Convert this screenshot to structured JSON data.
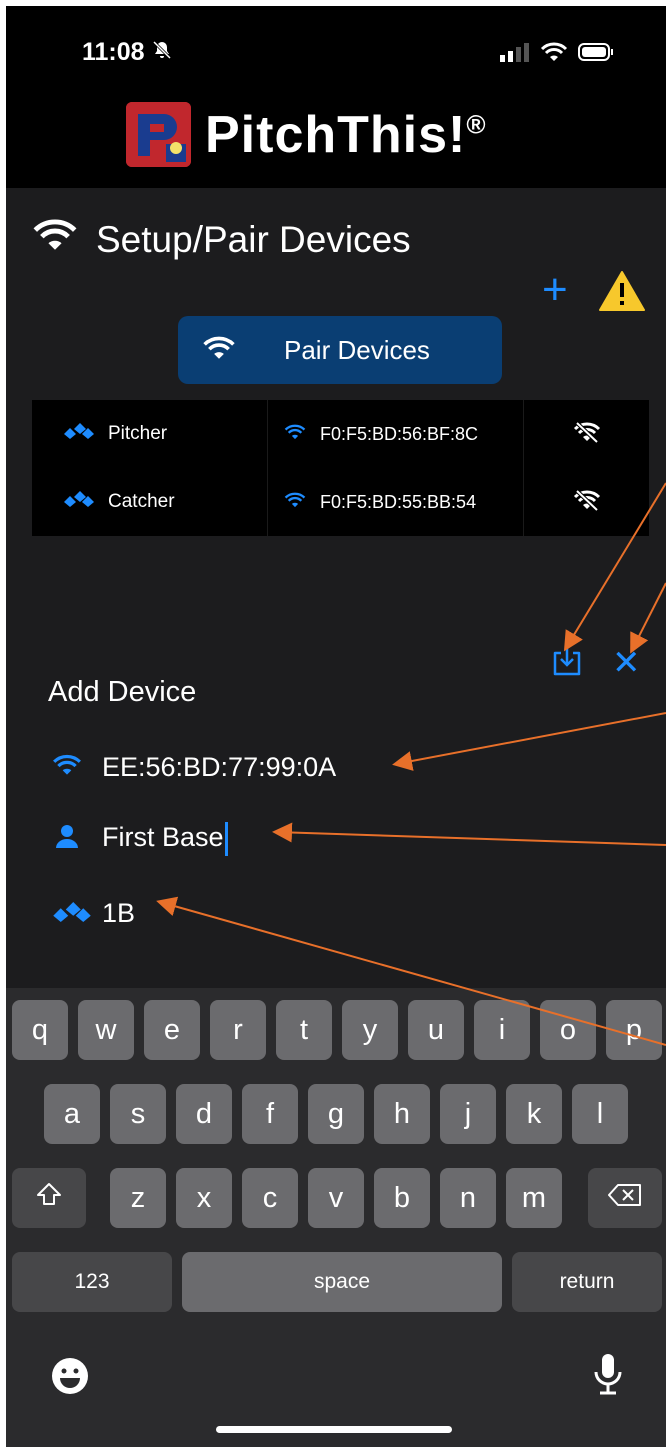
{
  "status": {
    "time": "11:08"
  },
  "app": {
    "brand": "PitchThis!",
    "trademark": "®"
  },
  "panel": {
    "title": "Setup/Pair Devices",
    "pair_button": "Pair Devices",
    "devices": [
      {
        "name": "Pitcher",
        "mac": "F0:F5:BD:56:BF:8C"
      },
      {
        "name": "Catcher",
        "mac": "F0:F5:BD:55:BB:54"
      }
    ]
  },
  "add_device": {
    "title": "Add Device",
    "mac": "EE:56:BD:77:99:0A",
    "name": "First Base",
    "short_name": "1B"
  },
  "keyboard": {
    "row1": [
      "q",
      "w",
      "e",
      "r",
      "t",
      "y",
      "u",
      "i",
      "o",
      "p"
    ],
    "row2": [
      "a",
      "s",
      "d",
      "f",
      "g",
      "h",
      "j",
      "k",
      "l"
    ],
    "row3": [
      "z",
      "x",
      "c",
      "v",
      "b",
      "n",
      "m"
    ],
    "numbers": "123",
    "space": "space",
    "return": "return"
  },
  "colors": {
    "accent": "#1e8cff",
    "pair_button": "#0a3e73",
    "annotation": "#e8702a"
  },
  "icons": [
    "bell-slash-icon",
    "signal-icon",
    "wifi-icon",
    "battery-icon",
    "plus-icon",
    "warning-icon",
    "cleats-icon",
    "wifi-off-icon",
    "save-icon",
    "close-icon",
    "person-icon",
    "shift-icon",
    "backspace-icon",
    "emoji-icon",
    "mic-icon"
  ]
}
